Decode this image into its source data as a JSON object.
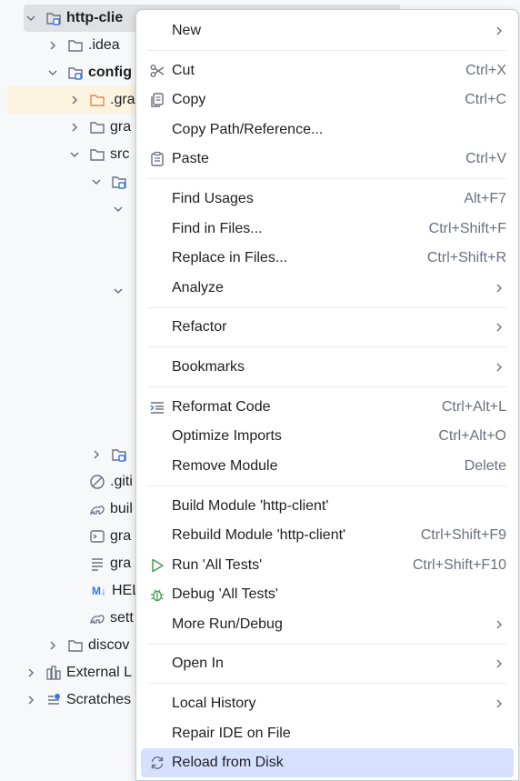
{
  "tree": {
    "rows": [
      {
        "label": "http-clie",
        "bold": true
      },
      {
        "label": ".idea"
      },
      {
        "label": "config",
        "bold": true
      },
      {
        "label": ".gra"
      },
      {
        "label": "gra"
      },
      {
        "label": "src"
      },
      {
        "label": ""
      },
      {
        "label": ".giti"
      },
      {
        "label": "buil"
      },
      {
        "label": "gra"
      },
      {
        "label": "gra"
      },
      {
        "label": "HEL"
      },
      {
        "label": "sett"
      },
      {
        "label": "discov"
      },
      {
        "label": "External L"
      },
      {
        "label": "Scratches"
      }
    ],
    "markdown_badge": "M↓"
  },
  "menu": {
    "items": [
      {
        "label": "New",
        "shortcut": ""
      },
      {
        "label": "Cut",
        "shortcut": "Ctrl+X"
      },
      {
        "label": "Copy",
        "shortcut": "Ctrl+C"
      },
      {
        "label": "Copy Path/Reference...",
        "shortcut": ""
      },
      {
        "label": "Paste",
        "shortcut": "Ctrl+V"
      },
      {
        "label": "Find Usages",
        "shortcut": "Alt+F7"
      },
      {
        "label": "Find in Files...",
        "shortcut": "Ctrl+Shift+F"
      },
      {
        "label": "Replace in Files...",
        "shortcut": "Ctrl+Shift+R"
      },
      {
        "label": "Analyze",
        "shortcut": ""
      },
      {
        "label": "Refactor",
        "shortcut": ""
      },
      {
        "label": "Bookmarks",
        "shortcut": ""
      },
      {
        "label": "Reformat Code",
        "shortcut": "Ctrl+Alt+L"
      },
      {
        "label": "Optimize Imports",
        "shortcut": "Ctrl+Alt+O"
      },
      {
        "label": "Remove Module",
        "shortcut": "Delete"
      },
      {
        "label": "Build Module 'http-client'",
        "shortcut": ""
      },
      {
        "label": "Rebuild Module 'http-client'",
        "shortcut": "Ctrl+Shift+F9"
      },
      {
        "label": "Run 'All Tests'",
        "shortcut": "Ctrl+Shift+F10"
      },
      {
        "label": "Debug 'All Tests'",
        "shortcut": ""
      },
      {
        "label": "More Run/Debug",
        "shortcut": ""
      },
      {
        "label": "Open In",
        "shortcut": ""
      },
      {
        "label": "Local History",
        "shortcut": ""
      },
      {
        "label": "Repair IDE on File",
        "shortcut": ""
      },
      {
        "label": "Reload from Disk",
        "shortcut": ""
      }
    ]
  },
  "colors": {
    "accent": "#3574f0",
    "selection": "#d5e1ff",
    "run_green": "#499c54",
    "folder_orange": "#e08855"
  }
}
